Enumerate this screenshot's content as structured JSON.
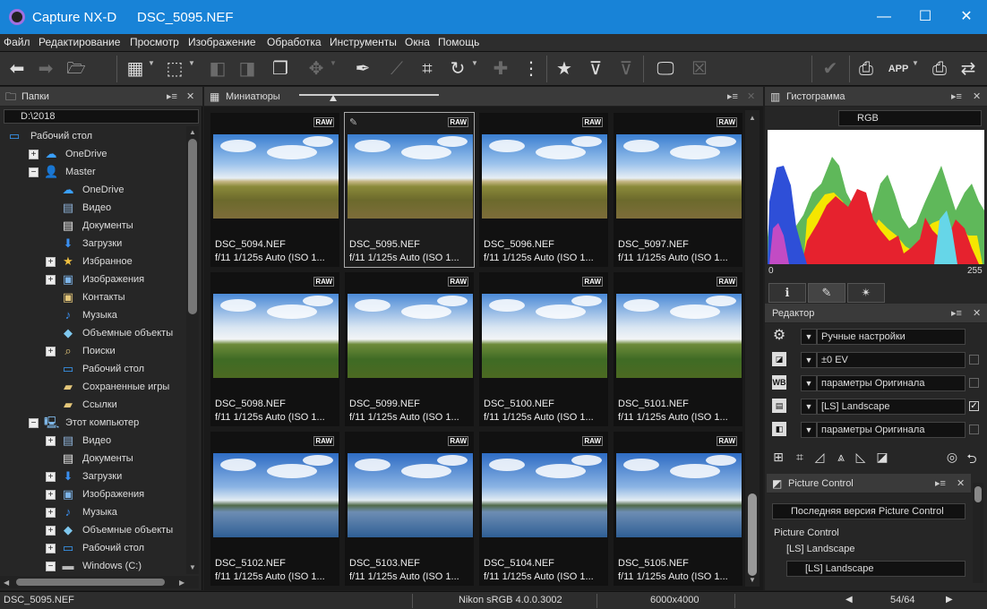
{
  "titlebar": {
    "app": "Capture NX-D",
    "file": "DSC_5095.NEF",
    "minimize": "—",
    "maximize": "☐",
    "close": "✕"
  },
  "menu": [
    "Файл",
    "Редактирование",
    "Просмотр",
    "Изображение",
    "Обработка",
    "Инструменты",
    "Окна",
    "Помощь"
  ],
  "folders": {
    "title": "Папки",
    "path": "D:\\2018",
    "tree": [
      {
        "label": "Рабочий стол",
        "indent": 0,
        "exp": "",
        "icon": "desktop"
      },
      {
        "label": "OneDrive",
        "indent": 1,
        "exp": "+",
        "icon": "cloud"
      },
      {
        "label": "Master",
        "indent": 1,
        "exp": "−",
        "icon": "user"
      },
      {
        "label": "OneDrive",
        "indent": 2,
        "exp": "",
        "icon": "cloud"
      },
      {
        "label": "Видео",
        "indent": 2,
        "exp": "",
        "icon": "film"
      },
      {
        "label": "Документы",
        "indent": 2,
        "exp": "",
        "icon": "doc"
      },
      {
        "label": "Загрузки",
        "indent": 2,
        "exp": "",
        "icon": "down"
      },
      {
        "label": "Избранное",
        "indent": 2,
        "exp": "+",
        "icon": "star"
      },
      {
        "label": "Изображения",
        "indent": 2,
        "exp": "+",
        "icon": "picture"
      },
      {
        "label": "Контакты",
        "indent": 2,
        "exp": "",
        "icon": "contact"
      },
      {
        "label": "Музыка",
        "indent": 2,
        "exp": "",
        "icon": "music"
      },
      {
        "label": "Объемные объекты",
        "indent": 2,
        "exp": "",
        "icon": "cube"
      },
      {
        "label": "Поиски",
        "indent": 2,
        "exp": "+",
        "icon": "search"
      },
      {
        "label": "Рабочий стол",
        "indent": 2,
        "exp": "",
        "icon": "desktop"
      },
      {
        "label": "Сохраненные игры",
        "indent": 2,
        "exp": "",
        "icon": "folder"
      },
      {
        "label": "Ссылки",
        "indent": 2,
        "exp": "",
        "icon": "link"
      },
      {
        "label": "Этот компьютер",
        "indent": 1,
        "exp": "−",
        "icon": "pc"
      },
      {
        "label": "Видео",
        "indent": 2,
        "exp": "+",
        "icon": "film"
      },
      {
        "label": "Документы",
        "indent": 2,
        "exp": "",
        "icon": "doc"
      },
      {
        "label": "Загрузки",
        "indent": 2,
        "exp": "+",
        "icon": "down"
      },
      {
        "label": "Изображения",
        "indent": 2,
        "exp": "+",
        "icon": "picture"
      },
      {
        "label": "Музыка",
        "indent": 2,
        "exp": "+",
        "icon": "music"
      },
      {
        "label": "Объемные объекты",
        "indent": 2,
        "exp": "+",
        "icon": "cube"
      },
      {
        "label": "Рабочий стол",
        "indent": 2,
        "exp": "+",
        "icon": "desktop"
      },
      {
        "label": "Windows (C:)",
        "indent": 2,
        "exp": "−",
        "icon": "drive"
      }
    ]
  },
  "thumbs": {
    "title": "Миниатюры",
    "items": [
      {
        "name": "DSC_5094.NEF",
        "info": "f/11 1/125s Auto (ISO 1...",
        "scene": "a",
        "selected": false,
        "edited": false
      },
      {
        "name": "DSC_5095.NEF",
        "info": "f/11 1/125s Auto (ISO 1...",
        "scene": "a",
        "selected": true,
        "edited": true
      },
      {
        "name": "DSC_5096.NEF",
        "info": "f/11 1/125s Auto (ISO 1...",
        "scene": "a",
        "selected": false,
        "edited": false
      },
      {
        "name": "DSC_5097.NEF",
        "info": "f/11 1/125s Auto (ISO 1...",
        "scene": "a",
        "selected": false,
        "edited": false
      },
      {
        "name": "DSC_5098.NEF",
        "info": "f/11 1/125s Auto (ISO 1...",
        "scene": "b",
        "selected": false,
        "edited": false
      },
      {
        "name": "DSC_5099.NEF",
        "info": "f/11 1/125s Auto (ISO 1...",
        "scene": "b",
        "selected": false,
        "edited": false
      },
      {
        "name": "DSC_5100.NEF",
        "info": "f/11 1/125s Auto (ISO 1...",
        "scene": "b",
        "selected": false,
        "edited": false
      },
      {
        "name": "DSC_5101.NEF",
        "info": "f/11 1/125s Auto (ISO 1...",
        "scene": "b",
        "selected": false,
        "edited": false
      },
      {
        "name": "DSC_5102.NEF",
        "info": "f/11 1/125s Auto (ISO 1...",
        "scene": "c",
        "selected": false,
        "edited": false
      },
      {
        "name": "DSC_5103.NEF",
        "info": "f/11 1/125s Auto (ISO 1...",
        "scene": "c",
        "selected": false,
        "edited": false
      },
      {
        "name": "DSC_5104.NEF",
        "info": "f/11 1/125s Auto (ISO 1...",
        "scene": "c",
        "selected": false,
        "edited": false
      },
      {
        "name": "DSC_5105.NEF",
        "info": "f/11 1/125s Auto (ISO 1...",
        "scene": "c",
        "selected": false,
        "edited": false
      }
    ],
    "raw_badge": "RAW"
  },
  "histogram": {
    "title": "Гистограмма",
    "channel": "RGB",
    "min": "0",
    "max": "255"
  },
  "editor": {
    "title": "Редактор",
    "rows": [
      {
        "icon": "gear",
        "value": "Ручные настройки",
        "check": null
      },
      {
        "icon": "ev",
        "value": "±0 EV",
        "check": false
      },
      {
        "icon": "wb",
        "value": "параметры Оригинала",
        "check": false
      },
      {
        "icon": "pc",
        "value": "[LS] Landscape",
        "check": true
      },
      {
        "icon": "tone",
        "value": "параметры Оригинала",
        "check": false
      }
    ]
  },
  "picture_control": {
    "title": "Picture Control",
    "version": "Последняя версия Picture Control",
    "label": "Picture Control",
    "current": "[LS] Landscape",
    "selected": "[LS] Landscape"
  },
  "status": {
    "file": "DSC_5095.NEF",
    "profile": "Nikon sRGB 4.0.0.3002",
    "size": "6000x4000",
    "counter": "54/64"
  },
  "colors": {
    "titlebar": "#1883d7",
    "panel": "#262626",
    "accent": "#a070e0"
  }
}
